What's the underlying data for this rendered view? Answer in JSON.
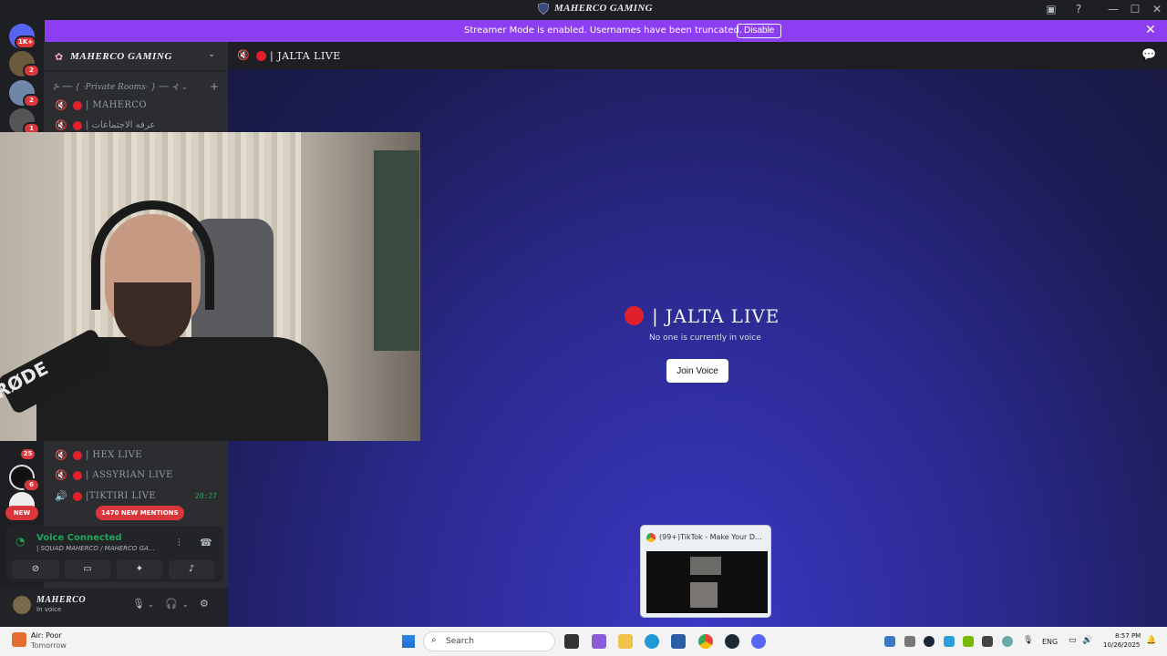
{
  "window": {
    "title": "MAHERCO GAMING",
    "controls": [
      "—",
      "☐",
      "✕"
    ]
  },
  "banner": {
    "message": "Streamer Mode is enabled. Usernames have been truncated.",
    "disable_label": "Disable",
    "close_icon": "✕"
  },
  "rail": {
    "badges": [
      "1K+",
      "2",
      "2",
      "1",
      "25",
      "6"
    ],
    "new_label": "NEW"
  },
  "server": {
    "name": "MAHERCO GAMING",
    "category": "⊱ ── { ·Private Rooms· } ── ⊰ ⌄",
    "channels_top": [
      {
        "label": "| MAHERCO"
      },
      {
        "label": "| عرفه الاجتماعات"
      }
    ],
    "channels_bottom": [
      {
        "label": "| HEX LIVE",
        "time": ""
      },
      {
        "label": "| ASSYRIAN LIVE",
        "time": ""
      },
      {
        "label": "|TIKTIRI LIVE",
        "time": "20:27"
      }
    ],
    "mentions": "1470 NEW MENTIONS"
  },
  "voice": {
    "status": "Voice Connected",
    "channel": "| SQUAD MAHERCO / MAHERCO GA..."
  },
  "user": {
    "name": "MAHERCO",
    "status": "In voice"
  },
  "channel_view": {
    "title": "| JALTA LIVE",
    "big_title": "| JALTA LIVE",
    "empty_message": "No one is currently in voice",
    "join_label": "Join Voice"
  },
  "webcam": {
    "mic_brand": "RØDE"
  },
  "preview": {
    "title": "(99+)TikTok - Make Your D..."
  },
  "taskbar": {
    "weather_line1": "Air: Poor",
    "weather_line2": "Tomorrow",
    "search_placeholder": "Search",
    "lang": "ENG",
    "time": "8:57 PM",
    "date": "10/26/2025"
  }
}
